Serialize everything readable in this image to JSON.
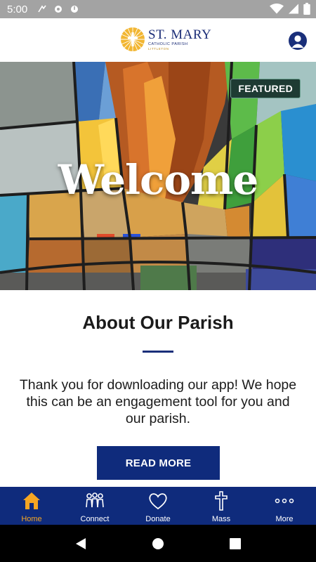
{
  "status_bar": {
    "time": "5:00"
  },
  "header": {
    "logo": {
      "name": "ST. MARY",
      "subtitle": "CATHOLIC PARISH",
      "location": "LITTLETON"
    },
    "profile_icon": "person-icon"
  },
  "hero": {
    "title": "Welcome",
    "badge": "FEATURED"
  },
  "about": {
    "title": "About Our Parish",
    "body": "Thank you for downloading our app! We hope this can be an engagement tool for you and our parish.",
    "button": "READ MORE"
  },
  "bottom_nav": {
    "active_color": "#f5a623",
    "background": "#0f2b7c",
    "items": [
      {
        "label": "Home",
        "icon": "home-icon",
        "active": true
      },
      {
        "label": "Connect",
        "icon": "people-icon",
        "active": false
      },
      {
        "label": "Donate",
        "icon": "heart-icon",
        "active": false
      },
      {
        "label": "Mass",
        "icon": "cross-icon",
        "active": false
      },
      {
        "label": "More",
        "icon": "more-icon",
        "active": false
      }
    ]
  },
  "system_nav": {
    "icons": [
      "back-icon",
      "home-circle-icon",
      "recents-icon"
    ]
  }
}
